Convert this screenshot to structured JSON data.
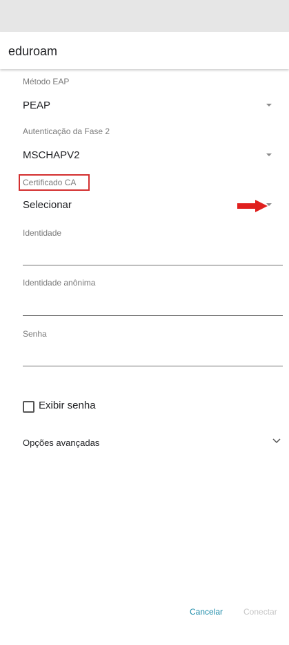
{
  "dialog": {
    "title": "eduroam"
  },
  "fields": {
    "eap_method": {
      "label": "Método EAP",
      "value": "PEAP"
    },
    "phase2_auth": {
      "label": "Autenticação da Fase 2",
      "value": "MSCHAPV2"
    },
    "ca_certificate": {
      "label": "Certificado CA",
      "value": "Selecionar"
    },
    "identity": {
      "label": "Identidade",
      "value": ""
    },
    "anonymous_identity": {
      "label": "Identidade anônima",
      "value": ""
    },
    "password": {
      "label": "Senha",
      "value": ""
    }
  },
  "show_password": {
    "label": "Exibir senha",
    "checked": false
  },
  "advanced_options": {
    "label": "Opções avançadas"
  },
  "buttons": {
    "cancel": "Cancelar",
    "connect": "Conectar"
  },
  "annotation": {
    "highlight_color": "#d32f2f"
  },
  "colors": {
    "accent": "#1a8aa8",
    "disabled": "#c7c7c7"
  },
  "icons": {
    "dropdown": "dropdown-arrow-icon",
    "annotation_arrow": "red-arrow-icon",
    "chevron": "chevron-down-icon"
  }
}
